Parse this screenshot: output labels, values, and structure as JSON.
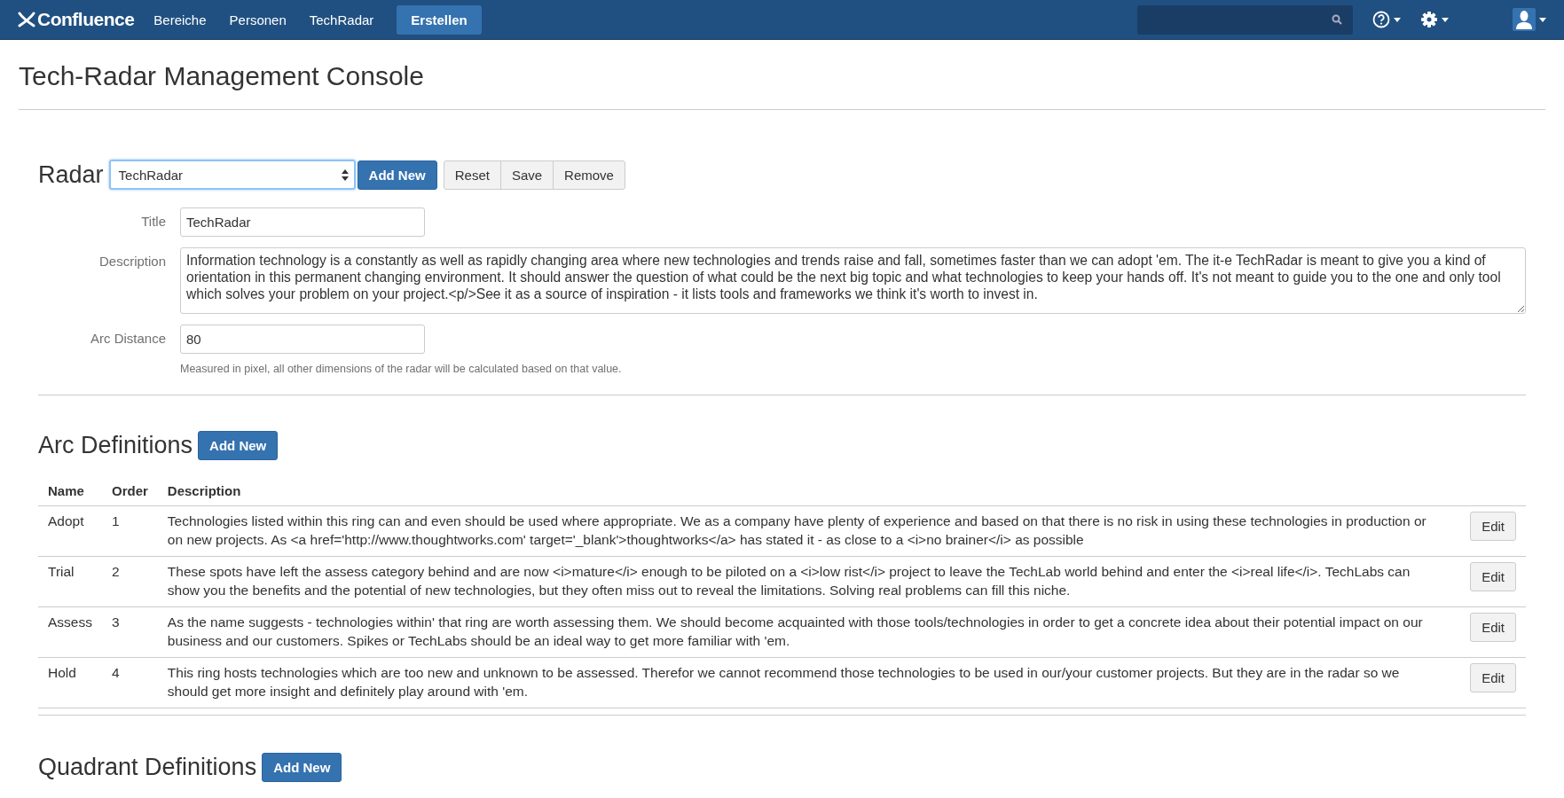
{
  "header": {
    "logo": "Confluence",
    "nav": [
      {
        "label": "Bereiche"
      },
      {
        "label": "Personen"
      },
      {
        "label": "TechRadar"
      }
    ],
    "create_button": "Erstellen"
  },
  "page_title": "Tech-Radar Management Console",
  "radar": {
    "heading": "Radar",
    "select_value": "TechRadar",
    "add_button": "Add New",
    "actions": [
      "Reset",
      "Save",
      "Remove"
    ],
    "fields": [
      {
        "kind": "input",
        "label": "Title",
        "value": "TechRadar"
      },
      {
        "kind": "textarea",
        "label": "Description",
        "value": "Information technology is a constantly as well as rapidly changing area where new technologies and trends raise and fall, sometimes faster than we can adopt 'em. The it-e TechRadar is meant to give you a kind of orientation in this permanent changing environment. It should answer the question of what could be the next big topic and what technologies to keep your hands off. It's not meant to guide you to the one and only tool which solves your problem on your project.<p/>See it as a source of inspiration - it lists tools and frameworks we think it's worth to invest in."
      },
      {
        "kind": "input",
        "label": "Arc Distance",
        "value": "80",
        "help": "Measured in pixel, all other dimensions of the radar will be calculated based on that value."
      }
    ]
  },
  "arc_definitions": {
    "heading": "Arc Definitions",
    "add_button": "Add New",
    "columns": [
      "Name",
      "Order",
      "Description"
    ],
    "rows": [
      {
        "name": "Adopt",
        "order": "1",
        "description": "Technologies listed within this ring can and even should be used where appropriate. We as a company have plenty of experience and based on that there is no risk in using these technologies in production or on new projects. As <a href='http://www.thoughtworks.com' target='_blank'>thoughtworks</a> has stated it - as close to a <i>no brainer</i> as possible",
        "action": "Edit"
      },
      {
        "name": "Trial",
        "order": "2",
        "description": "These spots have left the assess category behind and are now <i>mature</i> enough to be piloted on a <i>low rist</i> project to leave the TechLab world behind and enter the <i>real life</i>. TechLabs can show you the benefits and the potential of new technologies, but they often miss out to reveal the limitations. Solving real problems can fill this niche.",
        "action": "Edit"
      },
      {
        "name": "Assess",
        "order": "3",
        "description": "As the name suggests - technologies within' that ring are worth assessing them. We should become acquainted with those tools/technologies in order to get a concrete idea about their potential impact on our business and our customers. Spikes or TechLabs should be an ideal way to get more familiar with 'em.",
        "action": "Edit"
      },
      {
        "name": "Hold",
        "order": "4",
        "description": "This ring hosts technologies which are too new and unknown to be assessed. Therefor we cannot recommend those technologies to be used in our/your customer projects. But they are in the radar so we should get more insight and definitely play around with 'em.",
        "action": "Edit"
      }
    ]
  },
  "quadrant_definitions": {
    "heading": "Quadrant Definitions",
    "add_button": "Add New"
  }
}
